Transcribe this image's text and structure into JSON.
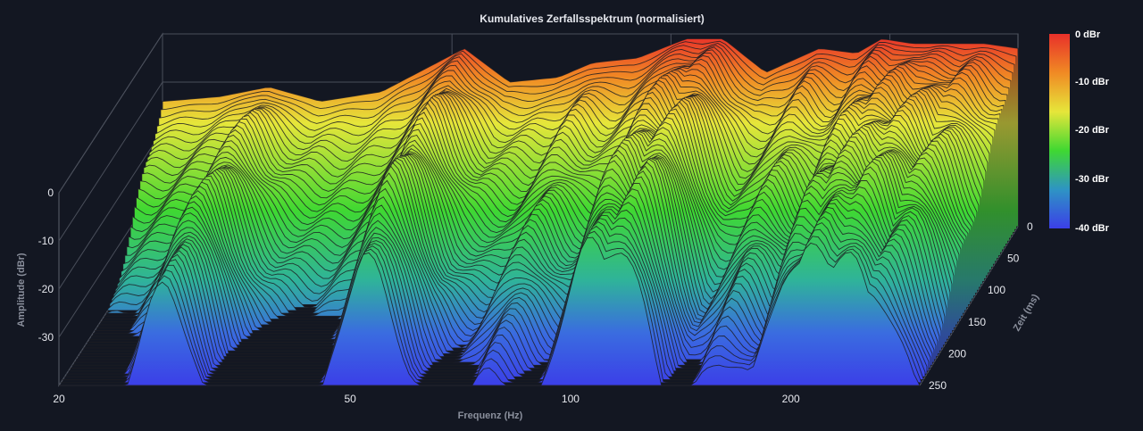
{
  "chart_data": {
    "type": "waterfall-3d",
    "title": "Kumulatives Zerfallsspektrum (normalisiert)",
    "xlabel": "Frequenz (Hz)",
    "ylabel": "Amplitude (dBr)",
    "zlabel": "Zeit (ms)",
    "x_scale": "log",
    "x_ticks": [
      20,
      50,
      100,
      200
    ],
    "x_range_hz": [
      20,
      300
    ],
    "y_ticks": [
      0,
      -10,
      -20,
      -30
    ],
    "y_range_dbr": [
      -40,
      0
    ],
    "z_ticks": [
      0,
      50,
      100,
      150,
      200,
      250
    ],
    "z_range_ms": [
      0,
      250
    ],
    "colorbar": {
      "labels": [
        "0 dBr",
        "-10 dBr",
        "-20 dBr",
        "-30 dBr",
        "-40 dBr"
      ],
      "colors": [
        "#e8302a",
        "#f08a24",
        "#e6e63a",
        "#3fd832",
        "#2e94c4",
        "#3b3fe8"
      ]
    },
    "peaks_hz": [
      28,
      52,
      78,
      105,
      118,
      160,
      195,
      215,
      240,
      270
    ],
    "first_slice_dbr": [
      {
        "hz": 20,
        "dbr": -14
      },
      {
        "hz": 24,
        "dbr": -13
      },
      {
        "hz": 28,
        "dbr": -11
      },
      {
        "hz": 33,
        "dbr": -14
      },
      {
        "hz": 40,
        "dbr": -12
      },
      {
        "hz": 52,
        "dbr": -3
      },
      {
        "hz": 60,
        "dbr": -10
      },
      {
        "hz": 70,
        "dbr": -9
      },
      {
        "hz": 78,
        "dbr": -6
      },
      {
        "hz": 90,
        "dbr": -5
      },
      {
        "hz": 105,
        "dbr": -1
      },
      {
        "hz": 118,
        "dbr": -1
      },
      {
        "hz": 135,
        "dbr": -8
      },
      {
        "hz": 160,
        "dbr": -3
      },
      {
        "hz": 180,
        "dbr": -4
      },
      {
        "hz": 195,
        "dbr": -1
      },
      {
        "hz": 215,
        "dbr": -2
      },
      {
        "hz": 240,
        "dbr": -2
      },
      {
        "hz": 270,
        "dbr": -2
      },
      {
        "hz": 300,
        "dbr": -3
      }
    ]
  }
}
